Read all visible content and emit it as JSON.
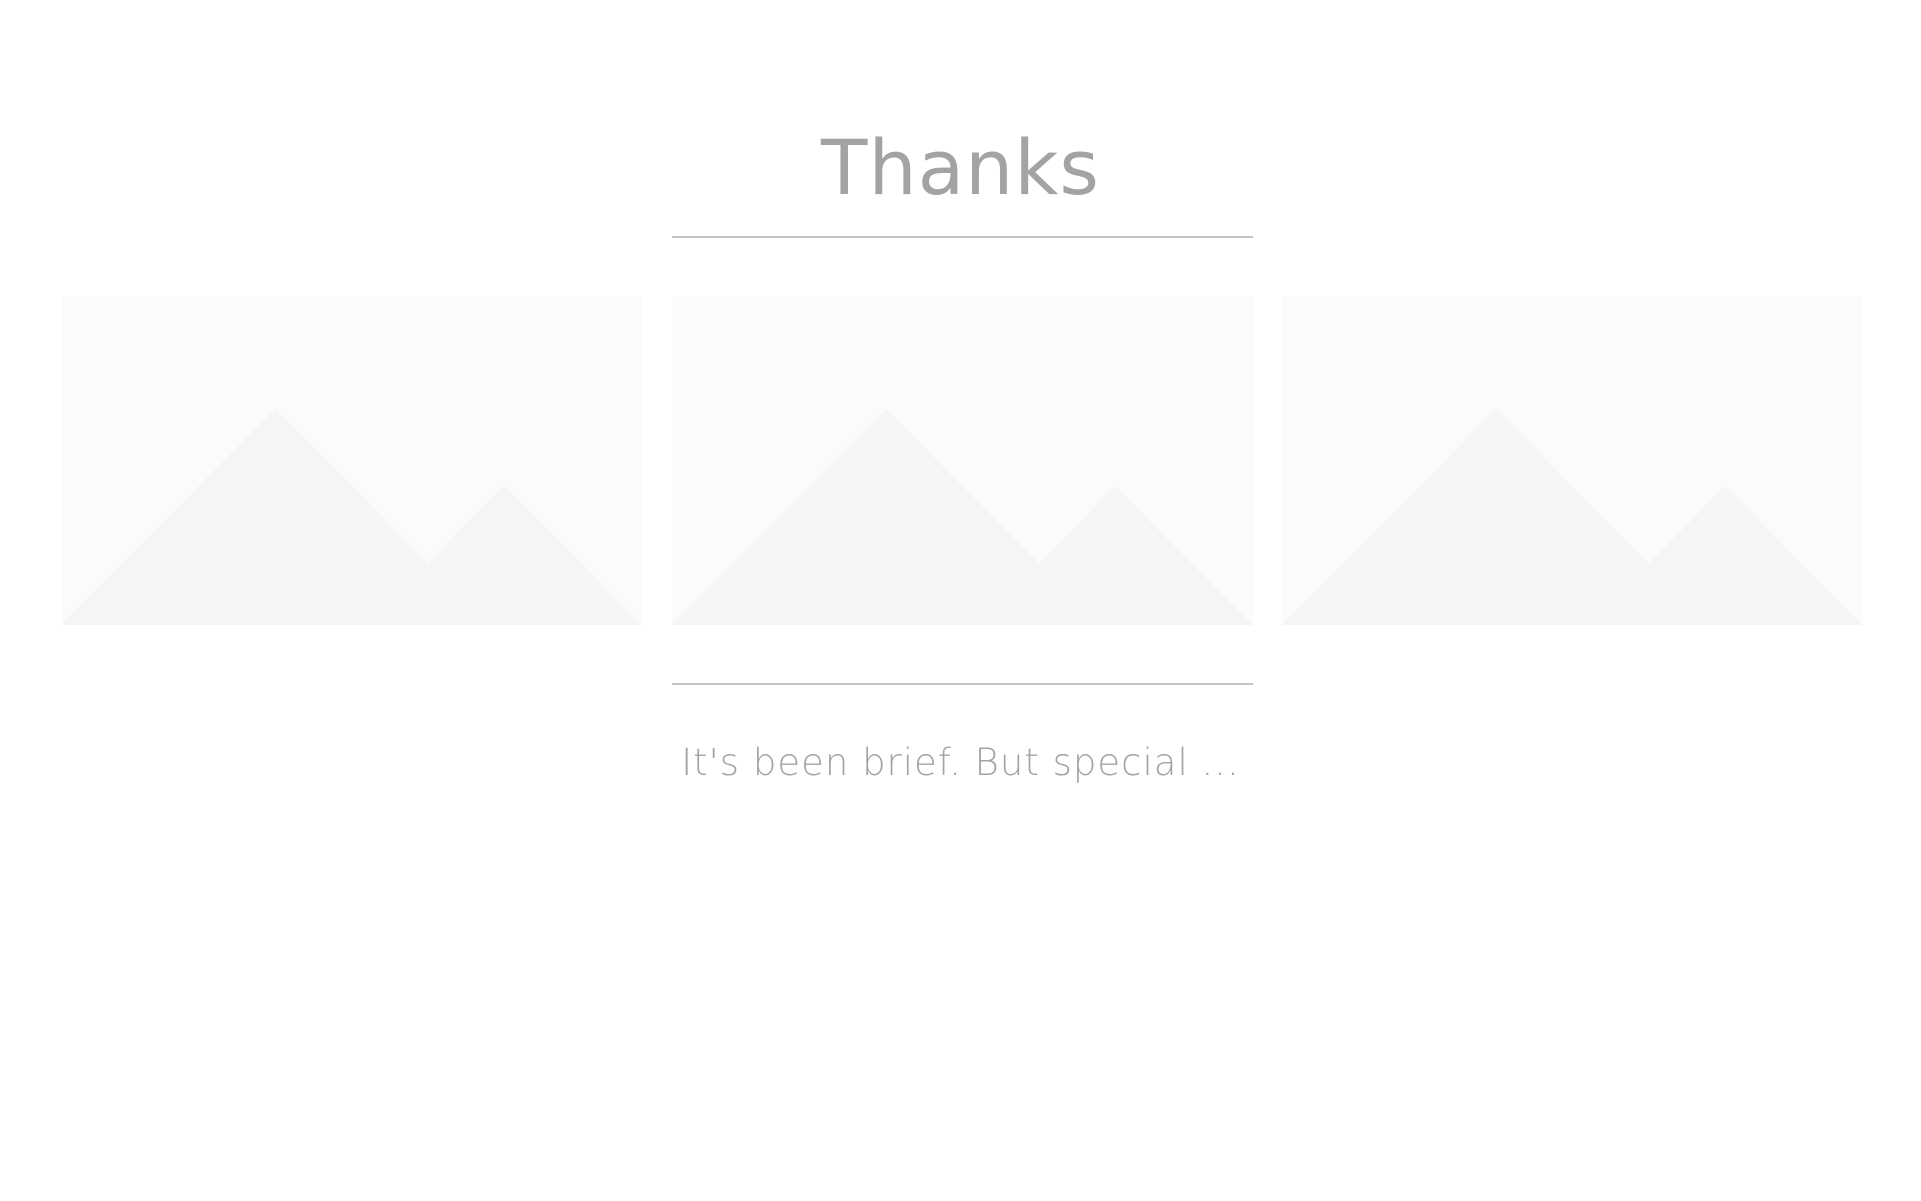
{
  "page": {
    "title": "Thanks",
    "subtitle": "It's been brief. But special ..."
  },
  "gallery": {
    "images": [
      {
        "icon": "image-placeholder-icon"
      },
      {
        "icon": "image-placeholder-icon"
      },
      {
        "icon": "image-placeholder-icon"
      }
    ]
  },
  "colors": {
    "background": "#ffffff",
    "text": "#a3a3a3",
    "divider": "#c4c4c4",
    "placeholder_bg": "#fbfbfb",
    "placeholder_mountain": "#f5f5f5"
  }
}
